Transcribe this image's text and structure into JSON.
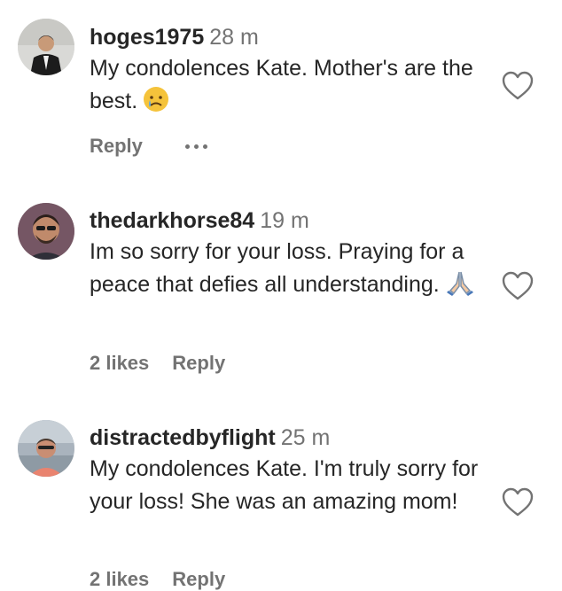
{
  "comments": [
    {
      "username": "hoges1975",
      "time": "28 m",
      "text": "My condolences Kate. Mother's are the best.",
      "emoji": "crying-face",
      "likes": "",
      "reply": "Reply",
      "has_more": true
    },
    {
      "username": "thedarkhorse84",
      "time": "19 m",
      "text": "Im so sorry for your loss. Praying for a peace that defies all understanding.",
      "emoji": "folded-hands",
      "likes": "2 likes",
      "reply": "Reply",
      "has_more": false
    },
    {
      "username": "distractedbyflight",
      "time": "25 m",
      "text": "My condolences Kate. I'm truly sorry for your loss! She was an amazing mom!",
      "emoji": "",
      "likes": "2 likes",
      "reply": "Reply",
      "has_more": false
    }
  ],
  "colors": {
    "username": "#262626",
    "meta": "#737373",
    "text": "#262626"
  }
}
